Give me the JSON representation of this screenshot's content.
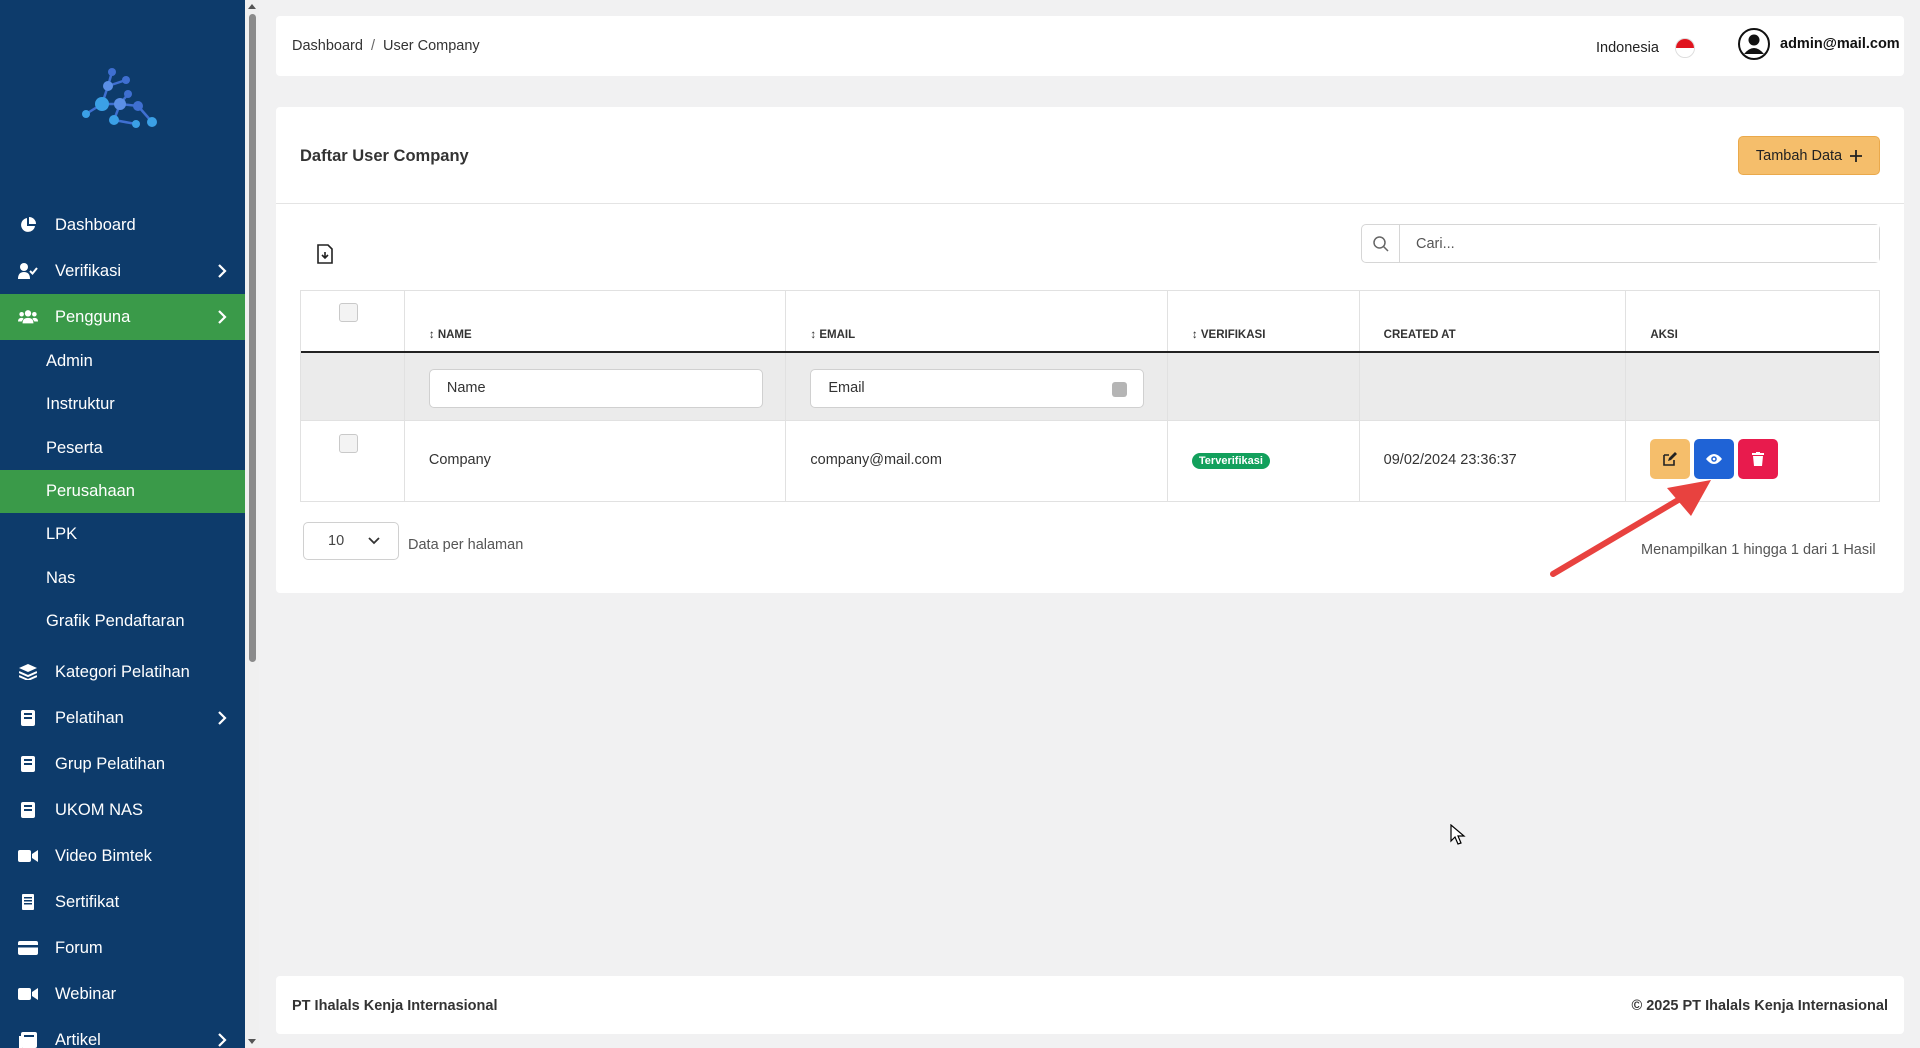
{
  "sidebar": {
    "items": [
      {
        "label": "Dashboard",
        "icon": "pie-chart-icon"
      },
      {
        "label": "Verifikasi",
        "icon": "user-check-icon"
      },
      {
        "label": "Pengguna",
        "icon": "users-icon"
      }
    ],
    "sub_items": [
      "Admin",
      "Instruktur",
      "Peserta",
      "Perusahaan",
      "LPK",
      "Nas",
      "Grafik Pendaftaran"
    ],
    "items_after": [
      {
        "label": "Kategori Pelatihan",
        "icon": "layers-icon"
      },
      {
        "label": "Pelatihan",
        "icon": "book-icon"
      },
      {
        "label": "Grup Pelatihan",
        "icon": "book-icon"
      },
      {
        "label": "UKOM NAS",
        "icon": "book-icon"
      },
      {
        "label": "Video Bimtek",
        "icon": "video-icon"
      },
      {
        "label": "Sertifikat",
        "icon": "certificate-icon"
      },
      {
        "label": "Forum",
        "icon": "card-icon"
      },
      {
        "label": "Webinar",
        "icon": "video-icon"
      },
      {
        "label": "Artikel",
        "icon": "newspaper-icon"
      }
    ]
  },
  "header": {
    "breadcrumb": [
      "Dashboard",
      "/",
      "User Company"
    ],
    "language": "Indonesia",
    "user_email": "admin@mail.com"
  },
  "card": {
    "title": "Daftar User Company",
    "add_button": "Tambah Data",
    "search_placeholder": "Cari...",
    "columns": [
      "↕ NAME",
      "↕ EMAIL",
      "↕ VERIFIKASI",
      "CREATED AT",
      "AKSI"
    ],
    "filters": {
      "name_placeholder": "Name",
      "email_placeholder": "Email"
    },
    "rows": [
      {
        "name": "Company",
        "email": "company@mail.com",
        "status": "Terverifikasi",
        "created_at": "09/02/2024 23:36:37"
      }
    ],
    "per_page": "10",
    "per_page_label": "Data per halaman",
    "summary": "Menampilkan 1 hingga 1 dari 1 Hasil"
  },
  "footer": {
    "left": "PT Ihalals Kenja Internasional",
    "right": "© 2025 PT Ihalals Kenja Internasional"
  },
  "colors": {
    "sidebar": "#0d3b6b",
    "active": "#3a9a49",
    "accent": "#f5be6b",
    "view": "#1f63d6",
    "delete": "#e81b4d",
    "verified": "#12a05c"
  }
}
